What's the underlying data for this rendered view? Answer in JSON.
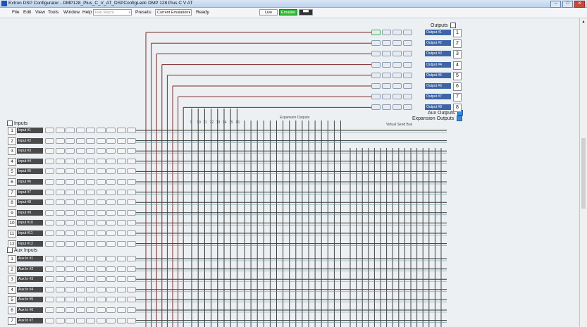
{
  "window": {
    "title": "Extron DSP Configurator - DMP128_Plus_C_V_AT_DSPConfigLedc DMP 128 Plus C V AT"
  },
  "menu": [
    "File",
    "Edit",
    "View",
    "Tools",
    "Window",
    "Help"
  ],
  "toolbar": {
    "mode_value": "Run Macro",
    "presets_label": "Presets:",
    "preset_value": "Current Emulation",
    "status": "Ready",
    "live_label": "Live",
    "emulate_label": "Emulate"
  },
  "sections": {
    "inputs": "Inputs",
    "aux_inputs": "Aux Inputs",
    "outputs": "Outputs",
    "aux_outputs": "Aux Outputs",
    "expansion_outputs": "Expansion Outputs",
    "expansion_outputs_small": "Expansion Outputs",
    "virtual_send_bus": "Virtual Send Bus"
  },
  "inputs": [
    {
      "num": "1",
      "name": "Input #1"
    },
    {
      "num": "2",
      "name": "Input #2"
    },
    {
      "num": "3",
      "name": "Input #3"
    },
    {
      "num": "4",
      "name": "Input #4"
    },
    {
      "num": "5",
      "name": "Input #5"
    },
    {
      "num": "6",
      "name": "Input #6"
    },
    {
      "num": "7",
      "name": "Input #7"
    },
    {
      "num": "8",
      "name": "Input #8"
    },
    {
      "num": "9",
      "name": "Input #9"
    },
    {
      "num": "10",
      "name": "Input #10"
    },
    {
      "num": "11",
      "name": "Input #11"
    },
    {
      "num": "12",
      "name": "Input #12"
    }
  ],
  "aux_inputs": [
    {
      "num": "1",
      "name": "Aux In #1"
    },
    {
      "num": "2",
      "name": "Aux In #2"
    },
    {
      "num": "3",
      "name": "Aux In #3"
    },
    {
      "num": "4",
      "name": "Aux In #4"
    },
    {
      "num": "5",
      "name": "Aux In #5"
    },
    {
      "num": "6",
      "name": "Aux In #6"
    },
    {
      "num": "7",
      "name": "Aux In #7"
    }
  ],
  "outputs": [
    {
      "num": "1",
      "name": "Output #1"
    },
    {
      "num": "2",
      "name": "Output #2"
    },
    {
      "num": "3",
      "name": "Output #3"
    },
    {
      "num": "4",
      "name": "Output #4"
    },
    {
      "num": "5",
      "name": "Output #5"
    },
    {
      "num": "6",
      "name": "Output #6"
    },
    {
      "num": "7",
      "name": "Output #7"
    },
    {
      "num": "8",
      "name": "Output #8"
    }
  ],
  "bus_numbers": [
    "9",
    "10",
    "11",
    "12",
    "13",
    "14",
    "15",
    "16"
  ]
}
